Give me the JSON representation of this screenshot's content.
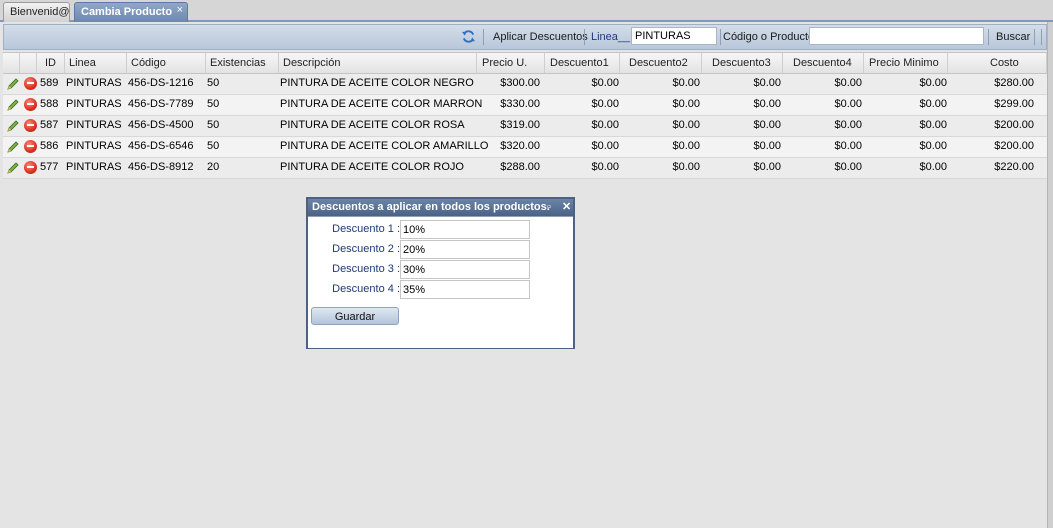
{
  "tabs": [
    {
      "label": "Bienvenid@",
      "active": false
    },
    {
      "label": "Cambia Producto",
      "active": true,
      "close": "×"
    }
  ],
  "toolbar": {
    "apply_label": "Aplicar Descuentos",
    "linea_label": "Linea__ :",
    "linea_value": "PINTURAS",
    "codigo_label": "Código o Producto :",
    "codigo_value": "",
    "search_label": "Buscar"
  },
  "grid": {
    "columns": [
      "ID",
      "Linea",
      "Código",
      "Existencias",
      "Descripción",
      "Precio U.",
      "Descuento1",
      "Descuento2",
      "Descuento3",
      "Descuento4",
      "Precio Minimo",
      "Costo"
    ],
    "rows": [
      {
        "id": "589",
        "linea": "PINTURAS",
        "codigo": "456-DS-1216",
        "existencias": "50",
        "descripcion": "PINTURA DE ACEITE COLOR NEGRO",
        "precio": "$300.00",
        "d1": "$0.00",
        "d2": "$0.00",
        "d3": "$0.00",
        "d4": "$0.00",
        "pmin": "$0.00",
        "costo": "$280.00"
      },
      {
        "id": "588",
        "linea": "PINTURAS",
        "codigo": "456-DS-7789",
        "existencias": "50",
        "descripcion": "PINTURA DE ACEITE COLOR MARRON",
        "precio": "$330.00",
        "d1": "$0.00",
        "d2": "$0.00",
        "d3": "$0.00",
        "d4": "$0.00",
        "pmin": "$0.00",
        "costo": "$299.00"
      },
      {
        "id": "587",
        "linea": "PINTURAS",
        "codigo": "456-DS-4500",
        "existencias": "50",
        "descripcion": "PINTURA DE ACEITE COLOR ROSA",
        "precio": "$319.00",
        "d1": "$0.00",
        "d2": "$0.00",
        "d3": "$0.00",
        "d4": "$0.00",
        "pmin": "$0.00",
        "costo": "$200.00"
      },
      {
        "id": "586",
        "linea": "PINTURAS",
        "codigo": "456-DS-6546",
        "existencias": "50",
        "descripcion": "PINTURA DE ACEITE COLOR AMARILLO",
        "precio": "$320.00",
        "d1": "$0.00",
        "d2": "$0.00",
        "d3": "$0.00",
        "d4": "$0.00",
        "pmin": "$0.00",
        "costo": "$200.00"
      },
      {
        "id": "577",
        "linea": "PINTURAS",
        "codigo": "456-DS-8912",
        "existencias": "20",
        "descripcion": "PINTURA DE ACEITE COLOR ROJO",
        "precio": "$288.00",
        "d1": "$0.00",
        "d2": "$0.00",
        "d3": "$0.00",
        "d4": "$0.00",
        "pmin": "$0.00",
        "costo": "$220.00"
      }
    ]
  },
  "dialog": {
    "title": "Descuentos a aplicar en todos los productos.",
    "fields": [
      {
        "label": "Descuento 1 :",
        "value": "10%"
      },
      {
        "label": "Descuento 2 :",
        "value": "20%"
      },
      {
        "label": "Descuento 3 :",
        "value": "30%"
      },
      {
        "label": "Descuento 4 :",
        "value": "35%"
      }
    ],
    "save_label": "Guardar"
  },
  "icons": {
    "edit": "pencil-icon",
    "delete": "delete-icon",
    "refresh": "refresh-icon"
  },
  "colors": {
    "tab_active": "#6d88ad",
    "dialog_title": "#4a6286",
    "label_blue": "#1e3a78",
    "delete_red": "#d8301f"
  }
}
